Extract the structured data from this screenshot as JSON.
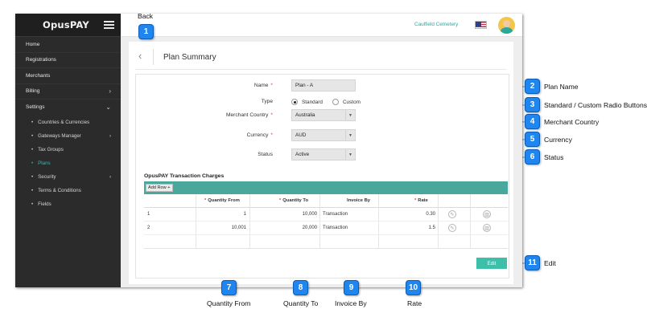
{
  "app": {
    "brand": "OpusPAY",
    "organization": "Caulfield Cemetery"
  },
  "sidebar": {
    "items": [
      {
        "label": "Home"
      },
      {
        "label": "Registrations"
      },
      {
        "label": "Merchants"
      },
      {
        "label": "Billing",
        "chevron": "›"
      },
      {
        "label": "Settings",
        "chevron": "⌄"
      }
    ],
    "settings_children": [
      {
        "label": "Countries & Currencies"
      },
      {
        "label": "Gateways Manager",
        "chevron": "›"
      },
      {
        "label": "Tax Groups"
      },
      {
        "label": "Plans",
        "active": true
      },
      {
        "label": "Security",
        "chevron": "›"
      },
      {
        "label": "Terms & Conditions"
      },
      {
        "label": "Fields"
      }
    ]
  },
  "page": {
    "back_icon": "‹",
    "title": "Plan Summary"
  },
  "form": {
    "name_label": "Name",
    "name_value": "Plan - A",
    "type_label": "Type",
    "type_options": [
      "Standard",
      "Custom"
    ],
    "type_selected": "Standard",
    "country_label": "Merchant Country",
    "country_value": "Australia",
    "currency_label": "Currency",
    "currency_value": "AUD",
    "status_label": "Status",
    "status_value": "Active",
    "required_mark": "*",
    "caret": "▼"
  },
  "charges": {
    "title": "OpusPAY Transaction Charges",
    "add_row_label": "Add Row +",
    "columns": [
      "Quantity From",
      "Quantity To",
      "Invoice By",
      "Rate"
    ],
    "rows": [
      {
        "index": "1",
        "from": "1",
        "to": "10,000",
        "invoice_by": "Transaction",
        "rate": "0.30"
      },
      {
        "index": "2",
        "from": "10,001",
        "to": "20,000",
        "invoice_by": "Transaction",
        "rate": "1.5"
      }
    ]
  },
  "actions": {
    "edit_label": "Edit"
  },
  "callouts": {
    "back": {
      "num": "1",
      "text": "Back"
    },
    "plan_name": {
      "num": "2",
      "text": "Plan Name"
    },
    "type": {
      "num": "3",
      "text": "Standard / Custom Radio Buttons"
    },
    "country": {
      "num": "4",
      "text": "Merchant Country"
    },
    "currency": {
      "num": "5",
      "text": "Currency"
    },
    "status": {
      "num": "6",
      "text": "Status"
    },
    "qty_from": {
      "num": "7",
      "text": "Quantity From"
    },
    "qty_to": {
      "num": "8",
      "text": "Quantity To"
    },
    "invoice_by": {
      "num": "9",
      "text": "Invoice By"
    },
    "rate": {
      "num": "10",
      "text": "Rate"
    },
    "edit": {
      "num": "11",
      "text": "Edit"
    }
  },
  "colors": {
    "accent": "#3ab5aa",
    "callout_blue": "#1e86ee",
    "table_header": "#4aa79b"
  }
}
